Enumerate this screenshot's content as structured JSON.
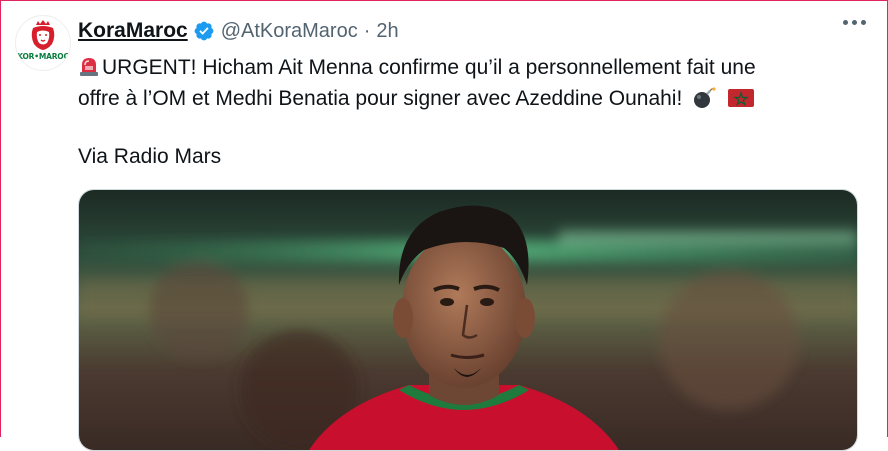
{
  "tweet": {
    "display_name": "KoraMaroc",
    "handle": "@AtKoraMaroc",
    "separator": "·",
    "time": "2h",
    "text_line1": "URGENT! Hicham Ait Menna confirme qu’il a personnellement fait une",
    "text_line2": "offre à l’OM et Medhi Benatia pour signer avec Azeddine Ounahi!",
    "via": "Via Radio Mars",
    "avatar_text": "KOR•MAROC",
    "emojis": [
      "rotating-light",
      "bomb",
      "morocco-flag"
    ]
  },
  "colors": {
    "verified": "#1d9bf0",
    "secondary_text": "#536471",
    "primary_text": "#0f1419",
    "frame_border": "#e0245e"
  }
}
